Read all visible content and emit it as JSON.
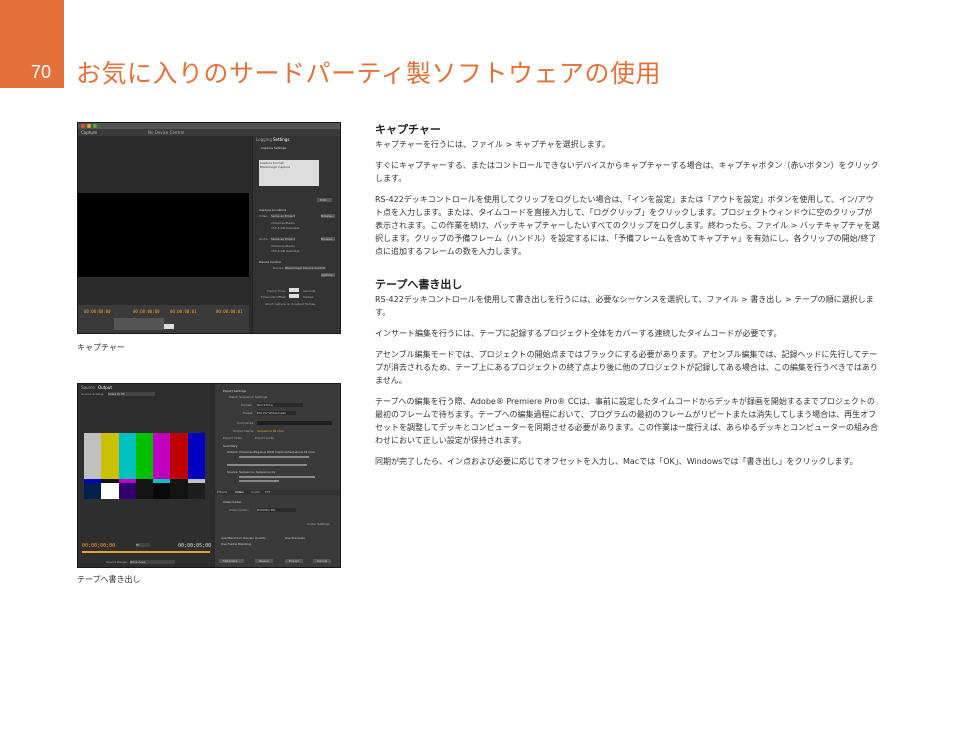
{
  "page": {
    "number": "70",
    "title": "お気に入りのサードパーティ製ソフトウェアの使用",
    "accent_color": "#e2713b"
  },
  "figures": [
    {
      "caption": "キャプチャー",
      "ui": {
        "tab_left": "Capture",
        "center_label": "No Device Control",
        "tab_logging": "Logging",
        "tab_settings": "Settings",
        "capture_settings": "Capture Settings",
        "capture_format": "Capture Format:",
        "capture_format_value": "Blackmagic Capture",
        "edit": "Edit...",
        "capture_locations": "Capture Locations",
        "video": "Video:",
        "audio": "Audio:",
        "same_as_project": "Same as Project",
        "browse": "Browse...",
        "path_prefix": "Path:",
        "path": "/Volumes/Media",
        "available": "155.6 GB Available",
        "device_control": "Device Control",
        "device": "Device:",
        "device_value": "Blackmagic Device Control",
        "options": "Options...",
        "preroll_label": "Preroll Time:",
        "preroll_unit": "seconds",
        "timecode_offset_label": "Timecode Offset:",
        "timecode_offset_unit": "frames",
        "abort": "Abort capture on dropped frames",
        "timecodes": [
          "00:00:00:00",
          "00:00:00:00",
          "00:00:00:01",
          "00:00:00:01"
        ]
      }
    },
    {
      "caption": "テープへ書き出し",
      "ui": {
        "tab_source": "Source",
        "tab_output": "Output",
        "source_scaling": "Source Scaling:",
        "source_scaling_value": "Scale To Fit",
        "export_settings": "Export Settings",
        "match_sequence": "Match Sequence Settings",
        "format": "Format:",
        "format_value": "QuickTime",
        "preset": "Preset:",
        "preset_value": "PAL DV Widescreen",
        "comments": "Comments:",
        "output_name": "Output Name:",
        "output_name_value": "Sequence 01.mov",
        "export_video": "Export Video",
        "export_audio": "Export Audio",
        "summary": "Summary",
        "output": "Output:",
        "output_value": "/Volumes/Pegasus R6/R Capture/Sequence 01.mov",
        "source": "Source:",
        "source_value": "Sequence, Sequence 01",
        "video_codec_section": "Video Codec",
        "video_codec": "Video Codec:",
        "video_codec_value": "DVCPRO PAL",
        "codec_settings": "Codec Settings",
        "tabs": [
          "Effects",
          "Video",
          "Audio",
          "FTP"
        ],
        "use_max_render": "Use Maximum Render Quality",
        "use_previews": "Use Previews",
        "use_frame_blending": "Use Frame Blending",
        "metadata": "Metadata...",
        "queue": "Queue",
        "export": "Export",
        "cancel": "Cancel",
        "tc_in": "00;00;00;00",
        "tc_out": "00;00;05;00",
        "fit": "Fit",
        "source_range": "Source Range:",
        "source_range_value": "Work Area"
      }
    }
  ],
  "sections": [
    {
      "heading": "キャプチャー",
      "paragraphs": [
        "キャプチャーを行うには、ファイル > キャプチャを選択します。",
        "すぐにキャプチャーする、またはコントロールできないデバイスからキャプチャーする場合は、キャプチャボタン（赤いボタン）をクリックします。",
        "RS-422デッキコントロールを使用してクリップをログしたい場合は、「インを設定」または「アウトを設定」ボタンを使用して、イン/アウト点を入力します。または、タイムコードを直接入力して、「ログクリップ」をクリックします。プロジェクトウィンドウに空のクリップが表示されます。この作業を続け、バッチキャプチャーしたいすべてのクリップをログします。終わったら、ファイル > バッチキャプチャを選択します。クリップの予備フレーム（ハンドル）を設定するには、「予備フレームを含めてキャプチャ」を有効にし、各クリップの開始/終了点に追加するフレームの数を入力します。"
      ]
    },
    {
      "heading": "テープへ書き出し",
      "paragraphs": [
        "RS-422デッキコントロールを使用して書き出しを行うには、必要なシーケンスを選択して、ファイル > 書き出し > テープの順に選択します。",
        "インサート編集を行うには、テープに記録するプロジェクト全体をカバーする連続したタイムコードが必要です。",
        "アセンブル編集モードでは、プロジェクトの開始点まではブラックにする必要があります。アセンブル編集では、記録ヘッドに先行してテープが消去されるため、テープ上にあるプロジェクトの終了点より後に他のプロジェクトが記録してある場合は、この編集を行うべきではありません。",
        "テープへの編集を行う際、Adobe® Premiere Pro® CCは、事前に設定したタイムコードからデッキが録画を開始するまでプロジェクトの最初のフレームで待ちます。テープへの編集過程において、プログラムの最初のフレームがリピートまたは消失してしまう場合は、再生オフセットを調整してデッキとコンピューターを同期させる必要があります。この作業は一度行えば、あらゆるデッキとコンピューターの組み合わせにおいて正しい設定が保持されます。",
        "同期が完了したら、イン点および必要に応じてオフセットを入力し、Macでは「OK」、Windowsでは「書き出し」をクリックします。"
      ]
    }
  ],
  "colors": {
    "bars_top": [
      "#c0c0c0",
      "#c8c000",
      "#00c0c0",
      "#00c000",
      "#c000c0",
      "#c00000",
      "#0000c0"
    ],
    "bars_mid": [
      "#0000c0",
      "#131313",
      "#c000c0",
      "#131313",
      "#00c0c0",
      "#131313",
      "#c0c0c0"
    ],
    "bars_bot": [
      "#00214c",
      "#ffffff",
      "#32006a",
      "#131313",
      "#090909",
      "#131313",
      "#1d1d1d"
    ]
  }
}
